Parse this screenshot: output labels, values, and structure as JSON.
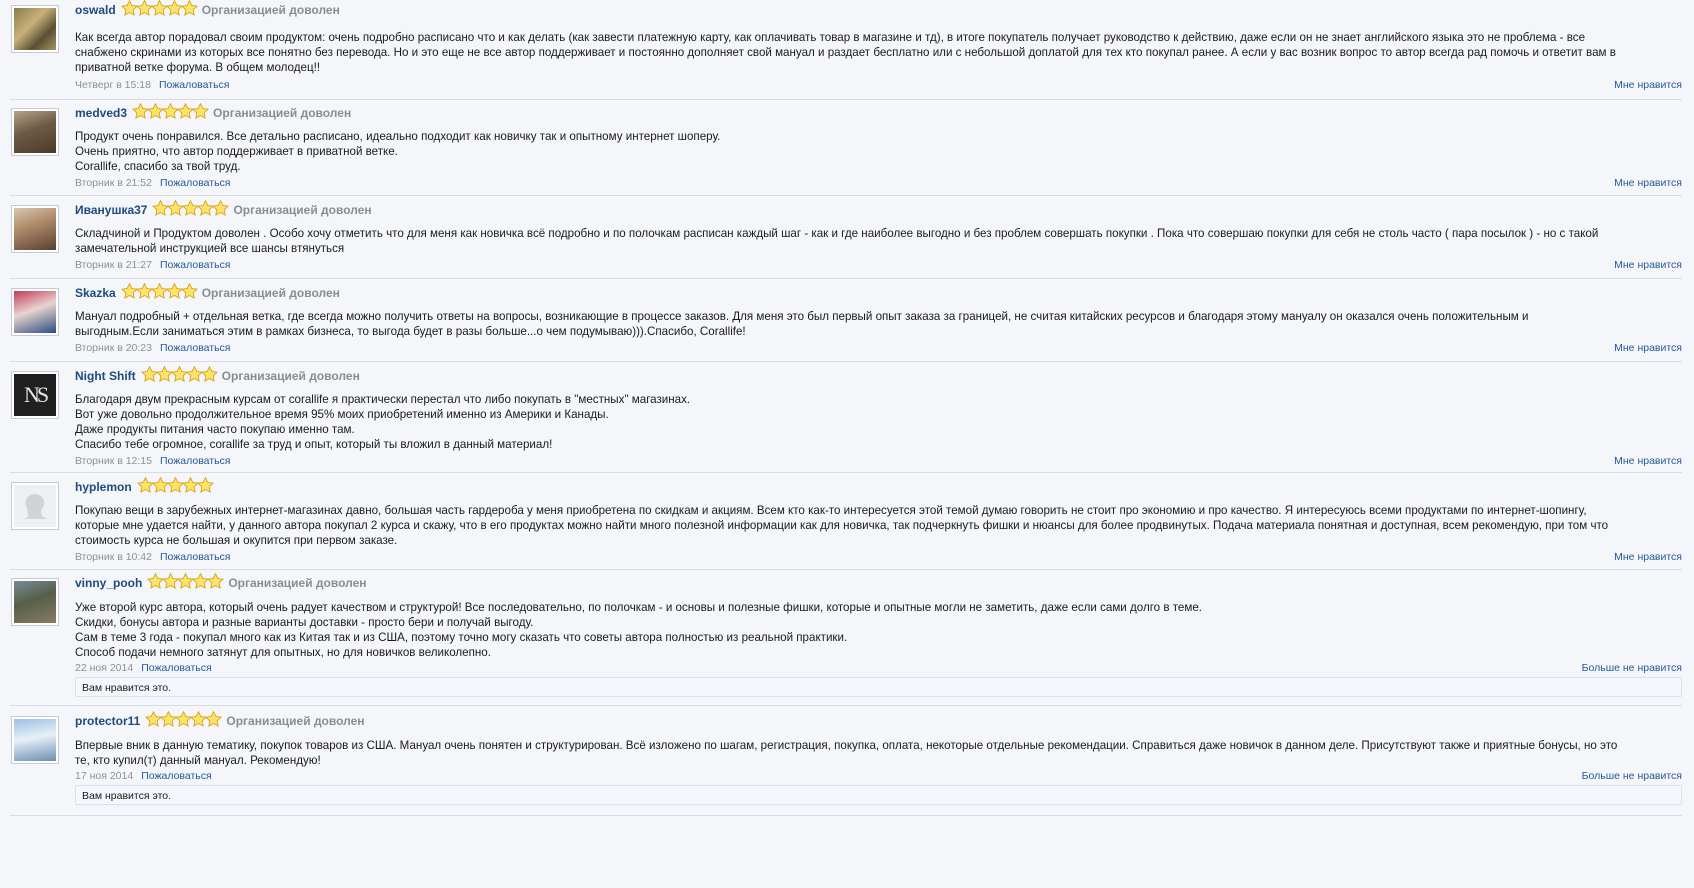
{
  "reviews": [
    {
      "username": "oswald",
      "status": "Организацией доволен",
      "rating": 5,
      "lines": [
        "Как всегда автор порадовал своим продуктом: очень подробно расписано что и как делать (как завести платежную карту, как оплачивать товар в магазине и тд), в итоге покупатель получает руководство к действию, даже если он не знает английского языка это не проблема - все",
        "снабжено скринами из которых все понятно без перевода. Но и это еще не все автор поддерживает и постоянно дополняет свой мануал и раздает бесплатно или с небольшой доплатой для тех кто покупал ранее. А если у вас возник вопрос то автор всегда рад помочь и ответит вам в",
        "приватной ветке форума. В общем молодец!!"
      ],
      "time": "Четверг в 15:18",
      "report_label": "Пожаловаться",
      "like_label": "Мне нравится",
      "avatar": "soldier-avatar"
    },
    {
      "username": "medved3",
      "status": "Организацией доволен",
      "rating": 5,
      "lines": [
        "Продукт очень понравился. Все детально расписано, идеально подходит как новичку так и опытному интернет шоперу.",
        "Очень приятно, что автор поддерживает в приватной ветке.",
        "Corallife, спасибо за твой труд."
      ],
      "time": "Вторник в 21:52",
      "report_label": "Пожаловаться",
      "like_label": "Мне нравится",
      "avatar": "bear-avatar"
    },
    {
      "username": "Иванушка37",
      "status": "Организацией доволен",
      "rating": 5,
      "lines": [
        "Складчиной и Продуктом доволен . Особо хочу отметить что для меня как новичка всё подробно и по полочкам расписан каждый шаг - как и где наиболее выгодно и без проблем совершать покупки . Пока что совершаю покупки для себя не столь часто ( пара посылок ) - но с такой",
        "замечательной инструкцией все шансы втянуться"
      ],
      "time": "Вторник в 21:27",
      "report_label": "Пожаловаться",
      "like_label": "Мне нравится",
      "avatar": "portrait-avatar"
    },
    {
      "username": "Skazka",
      "status": "Организацией доволен",
      "rating": 5,
      "lines": [
        "Мануал подробный + отдельная ветка, где всегда можно получить ответы на вопросы, возникающие в процессе заказов. Для меня это был первый опыт заказа за границей, не считая китайских ресурсов и благодаря этому мануалу он оказался очень положительным и",
        "выгодным.Если заниматься этим в рамках бизнеса, то выгода будет в разы больше...о чем подумываю))).Спасибо, Corallife!"
      ],
      "time": "Вторник в 20:23",
      "report_label": "Пожаловаться",
      "like_label": "Мне нравится",
      "avatar": "woman-sign-avatar"
    },
    {
      "username": "Night Shift",
      "status": "Организацией доволен",
      "rating": 5,
      "lines": [
        "Благодаря двум прекрасным курсам от corallife я практически перестал что либо покупать в \"местных\" магазинах.",
        "Вот уже довольно продолжительное время 95% моих приобретений именно из Америки и Канады.",
        "Даже продукты питания часто покупаю именно там.",
        "Спасибо тебе огромное, corallife за труд и опыт, который ты вложил в данный материал!"
      ],
      "time": "Вторник в 12:15",
      "report_label": "Пожаловаться",
      "like_label": "Мне нравится",
      "avatar": "ns-logo-avatar",
      "avatar_text": "NS"
    },
    {
      "username": "hyplemon",
      "status": "",
      "rating": 5,
      "lines": [
        "Покупаю вещи в зарубежных интернет-магазинах давно, большая часть гардероба у меня приобретена по скидкам и акциям. Всем кто как-то интересуется этой темой думаю говорить не стоит про экономию и про качество. Я интересуюсь всеми продуктами по интернет-шопингу,",
        "которые мне удается найти, у данного автора покупал 2 курса и скажу, что в его продуктах можно найти много полезной информации как для новичка, так подчеркнуть фишки и нюансы для более продвинутых. Подача материала понятная и доступная, всем рекомендую, при том что",
        "стоимость курса не большая и окупится при первом заказе."
      ],
      "time": "Вторник в 10:42",
      "report_label": "Пожаловаться",
      "like_label": "Мне нравится",
      "avatar": "default-silhouette-avatar"
    },
    {
      "username": "vinny_pooh",
      "status": "Организацией доволен",
      "rating": 5,
      "lines": [
        "Уже второй курс автора, который очень радует качеством и структурой! Все последовательно, по полочкам - и основы и полезные фишки, которые и опытные могли не заметить, даже если сами долго в теме.",
        "Скидки, бонусы автора и разные варианты доставки - просто бери и получай выгоду.",
        "Сам в теме 3 года - покупал много как из Китая так и из США, поэтому точно могу сказать что советы автора полностью из реальной практики.",
        "Способ подачи немного затянут для опытных, но для новичков великолепно."
      ],
      "time": "22 ноя 2014",
      "report_label": "Пожаловаться",
      "like_label": "Больше не нравится",
      "liked_note": "Вам нравится это.",
      "avatar": "rifle-avatar"
    },
    {
      "username": "protector11",
      "status": "Организацией доволен",
      "rating": 5,
      "lines": [
        "Впервые вник в данную тематику, покупок товаров из США. Мануал очень понятен и структурирован. Всё изложено по шагам, регистрация, покупка, оплата, некоторые отдельные рекомендации. Справиться даже новичок в данном деле. Присутствуют также и приятные бонусы, но это",
        "те, кто купил(т) данный мануал. Рекомендую!"
      ],
      "time": "17 ноя 2014",
      "report_label": "Пожаловаться",
      "like_label": "Больше не нравится",
      "liked_note": "Вам нравится это.",
      "avatar": "jet-avatar"
    }
  ],
  "colors": {
    "username": "#1d4a80",
    "link": "#25599a",
    "muted": "#8c9098",
    "star_fill": "#fce36a",
    "star_stroke": "#d8a21a"
  }
}
